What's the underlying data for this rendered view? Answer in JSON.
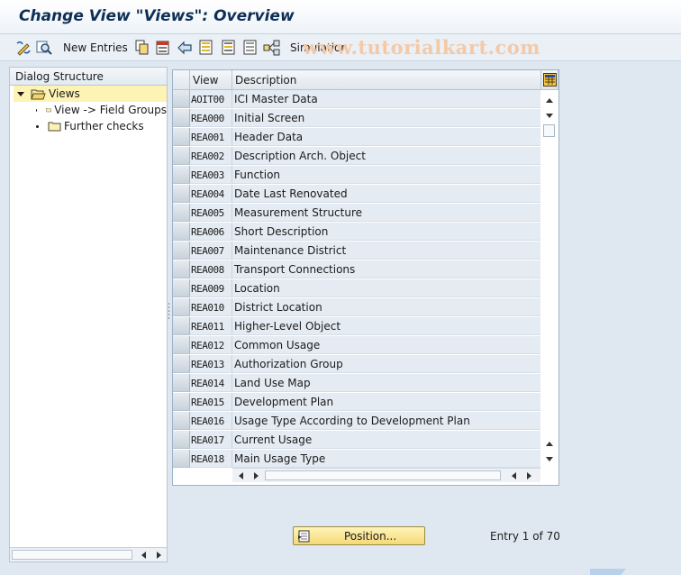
{
  "window": {
    "title": "Change View \"Views\": Overview"
  },
  "toolbar": {
    "new_entries_label": "New Entries",
    "simulation_label": "Simulation"
  },
  "watermark": "www.tutorialkart.com",
  "dialog_structure": {
    "header": "Dialog Structure",
    "items": [
      {
        "label": "Views",
        "level": 0,
        "expanded": true,
        "selected": true
      },
      {
        "label": "View -> Field Groups",
        "level": 1
      },
      {
        "label": "Further checks",
        "level": 1
      }
    ]
  },
  "table": {
    "columns": {
      "view": "View",
      "description": "Description"
    },
    "rows": [
      {
        "view": "AOIT00",
        "description": "ICI Master Data"
      },
      {
        "view": "REA000",
        "description": "Initial Screen"
      },
      {
        "view": "REA001",
        "description": "Header Data"
      },
      {
        "view": "REA002",
        "description": "Description Arch. Object"
      },
      {
        "view": "REA003",
        "description": "Function"
      },
      {
        "view": "REA004",
        "description": "Date Last Renovated"
      },
      {
        "view": "REA005",
        "description": "Measurement Structure"
      },
      {
        "view": "REA006",
        "description": "Short Description"
      },
      {
        "view": "REA007",
        "description": "Maintenance District"
      },
      {
        "view": "REA008",
        "description": "Transport Connections"
      },
      {
        "view": "REA009",
        "description": "Location"
      },
      {
        "view": "REA010",
        "description": "District Location"
      },
      {
        "view": "REA011",
        "description": "Higher-Level Object"
      },
      {
        "view": "REA012",
        "description": "Common Usage"
      },
      {
        "view": "REA013",
        "description": "Authorization Group"
      },
      {
        "view": "REA014",
        "description": "Land Use Map"
      },
      {
        "view": "REA015",
        "description": "Development Plan"
      },
      {
        "view": "REA016",
        "description": "Usage Type According to Development Plan"
      },
      {
        "view": "REA017",
        "description": "Current Usage"
      },
      {
        "view": "REA018",
        "description": "Main Usage Type"
      }
    ]
  },
  "footer": {
    "position_button_label": "Position...",
    "entry_info": "Entry 1 of 70"
  },
  "colors": {
    "background": "#dfe8f1",
    "title": "#0e2f55",
    "selected_tree_item": "#fdf3b5",
    "position_button": "#f5d978"
  },
  "icons": [
    "display-change-icon",
    "find-icon",
    "copy-icon",
    "delete-icon",
    "undo-icon",
    "select-all-icon",
    "select-block-icon",
    "deselect-all-icon",
    "transport-icon",
    "table-settings-icon",
    "position-icon"
  ]
}
